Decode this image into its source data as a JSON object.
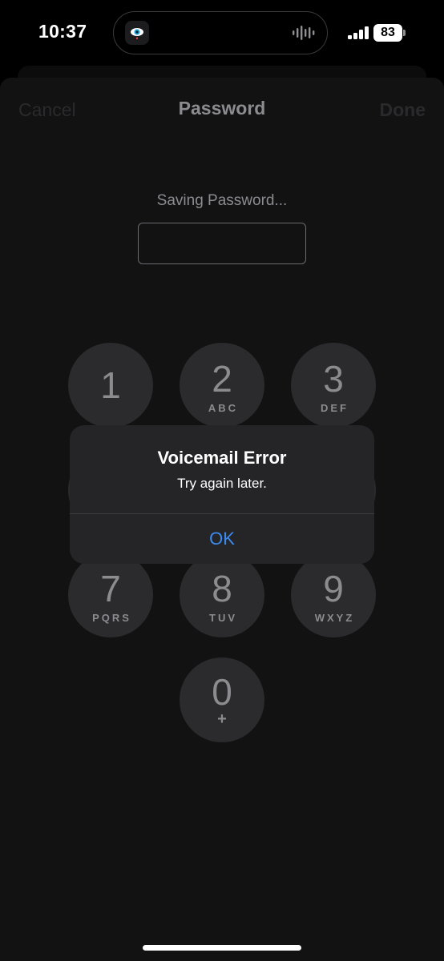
{
  "status_bar": {
    "time": "10:37",
    "battery": "83",
    "icons": [
      "eye-app-icon",
      "audio-waveform-icon",
      "cellular-signal-icon",
      "battery-icon"
    ]
  },
  "nav": {
    "cancel": "Cancel",
    "title": "Password",
    "done": "Done"
  },
  "prompt": "Saving Password...",
  "password_field": {
    "value": ""
  },
  "keypad": {
    "k1": {
      "digit": "1",
      "letters": ""
    },
    "k2": {
      "digit": "2",
      "letters": "ABC"
    },
    "k3": {
      "digit": "3",
      "letters": "DEF"
    },
    "k7": {
      "digit": "7",
      "letters": "PQRS"
    },
    "k8": {
      "digit": "8",
      "letters": "TUV"
    },
    "k9": {
      "digit": "9",
      "letters": "WXYZ"
    },
    "k0": {
      "digit": "0",
      "letters": "+"
    }
  },
  "alert": {
    "title": "Voicemail Error",
    "message": "Try again later.",
    "ok": "OK"
  },
  "colors": {
    "background": "#000000",
    "sheet": "#121213",
    "key": "#2b2b2d",
    "alert": "#252527",
    "accent": "#3d8bf0"
  }
}
